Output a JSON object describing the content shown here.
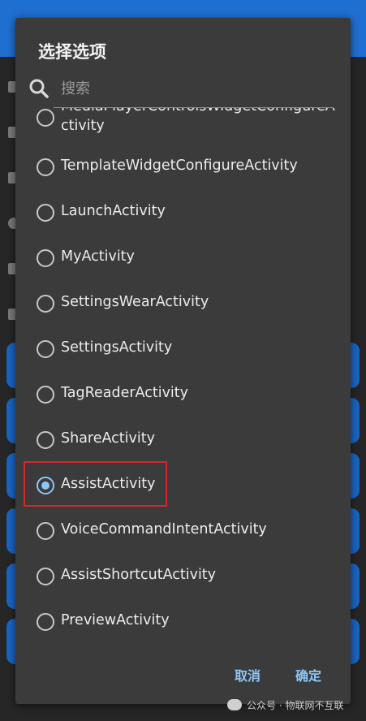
{
  "dialog": {
    "title": "选择选项",
    "search": {
      "placeholder": "搜索",
      "value": ""
    },
    "options": [
      {
        "label_line1": "MediaPlayerControlsWidgetConfigureA",
        "label_line2": "ctivity",
        "checked": false
      },
      {
        "label": "TemplateWidgetConfigureActivity",
        "checked": false
      },
      {
        "label": "LaunchActivity",
        "checked": false
      },
      {
        "label": "MyActivity",
        "checked": false
      },
      {
        "label": "SettingsWearActivity",
        "checked": false
      },
      {
        "label": "SettingsActivity",
        "checked": false
      },
      {
        "label": "TagReaderActivity",
        "checked": false
      },
      {
        "label": "ShareActivity",
        "checked": false
      },
      {
        "label": "AssistActivity",
        "checked": true
      },
      {
        "label": "VoiceCommandIntentActivity",
        "checked": false
      },
      {
        "label": "AssistShortcutActivity",
        "checked": false
      },
      {
        "label": "PreviewActivity",
        "checked": false
      }
    ],
    "cancel_label": "取消",
    "confirm_label": "确定"
  },
  "watermark": {
    "text": "公众号 · 物联网不互联"
  },
  "colors": {
    "accent": "#8ec5f7",
    "dialog_bg": "#3b3b3b",
    "highlight": "#d6262c",
    "app_bar": "#1f6fd1"
  }
}
